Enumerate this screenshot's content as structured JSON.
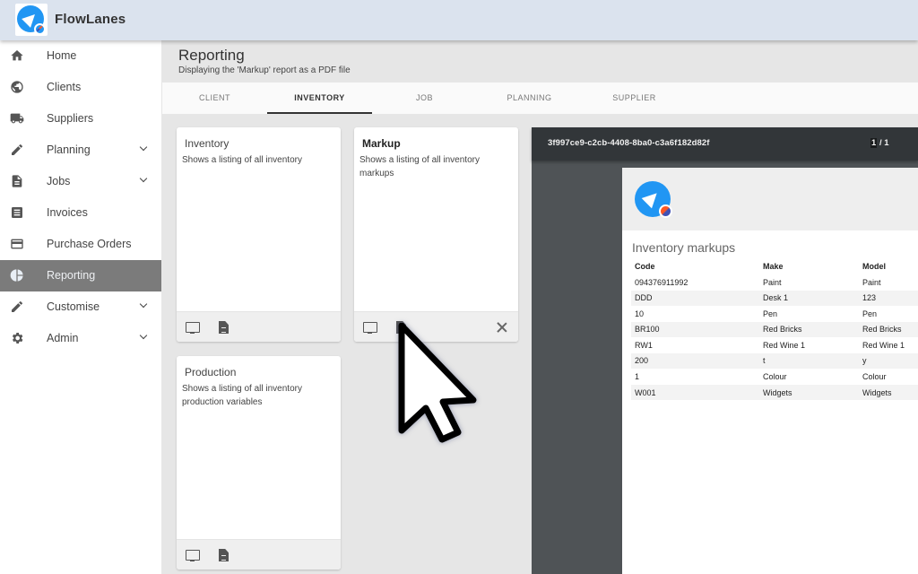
{
  "app": {
    "title": "FlowLanes",
    "logo_icon": "navigation-arrow-icon"
  },
  "sidebar": {
    "items": [
      {
        "label": "Home",
        "icon": "home-icon",
        "expandable": false,
        "active": false
      },
      {
        "label": "Clients",
        "icon": "globe-icon",
        "expandable": false,
        "active": false
      },
      {
        "label": "Suppliers",
        "icon": "truck-icon",
        "expandable": false,
        "active": false
      },
      {
        "label": "Planning",
        "icon": "pencil-icon",
        "expandable": true,
        "active": false
      },
      {
        "label": "Jobs",
        "icon": "document-icon",
        "expandable": true,
        "active": false
      },
      {
        "label": "Invoices",
        "icon": "list-icon",
        "expandable": false,
        "active": false
      },
      {
        "label": "Purchase Orders",
        "icon": "credit-card-icon",
        "expandable": false,
        "active": false
      },
      {
        "label": "Reporting",
        "icon": "pie-chart-icon",
        "expandable": false,
        "active": true
      },
      {
        "label": "Customise",
        "icon": "pencil-icon",
        "expandable": true,
        "active": false
      },
      {
        "label": "Admin",
        "icon": "gear-icon",
        "expandable": true,
        "active": false
      }
    ]
  },
  "header": {
    "title": "Reporting",
    "subtitle": "Displaying the 'Markup' report as a PDF file"
  },
  "tabs": [
    {
      "label": "CLIENT",
      "active": false
    },
    {
      "label": "INVENTORY",
      "active": true
    },
    {
      "label": "JOB",
      "active": false
    },
    {
      "label": "PLANNING",
      "active": false
    },
    {
      "label": "SUPPLIER",
      "active": false
    }
  ],
  "reports": [
    {
      "title": "Inventory",
      "description": "Shows a listing of all inventory",
      "selected": false
    },
    {
      "title": "Markup",
      "description": "Shows a listing of all inventory markups",
      "selected": true
    },
    {
      "title": "Production",
      "description": "Shows a listing of all inventory production variables",
      "selected": false
    }
  ],
  "pdf_viewer": {
    "filename": "3f997ce9-c2cb-4408-8ba0-c3a6f182d82f",
    "current_page": "1",
    "page_separator": "/ 1",
    "document": {
      "title": "Inventory markups",
      "columns": [
        "Code",
        "Make",
        "Model"
      ],
      "rows": [
        [
          "094376911992",
          "Paint",
          "Paint"
        ],
        [
          "DDD",
          "Desk 1",
          "123"
        ],
        [
          "10",
          "Pen",
          "Pen"
        ],
        [
          "BR100",
          "Red Bricks",
          "Red Bricks"
        ],
        [
          "RW1",
          "Red Wine 1",
          "Red Wine 1"
        ],
        [
          "200",
          "t",
          "y"
        ],
        [
          "1",
          "Colour",
          "Colour"
        ],
        [
          "W001",
          "Widgets",
          "Widgets"
        ]
      ]
    }
  },
  "colors": {
    "brand": "#2196f3",
    "topbar": "#dbe3ee",
    "active_nav": "#7b7b7b",
    "pdf_toolbar": "#323639"
  }
}
